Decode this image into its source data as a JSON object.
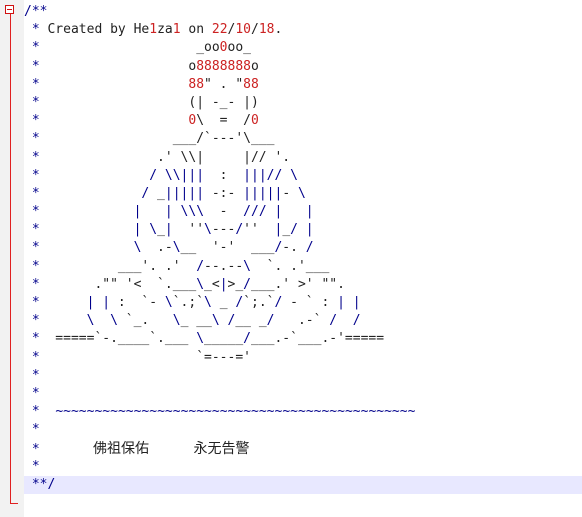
{
  "editor": {
    "lines": [
      {
        "star": "/**",
        "text": ""
      },
      {
        "star": " *",
        "text": " Created by He1za1 on 22/10/18."
      },
      {
        "star": " *",
        "text": "                    _oo0oo_"
      },
      {
        "star": " *",
        "text": "                   o8888888o"
      },
      {
        "star": " *",
        "text": "                   88\" . \"88"
      },
      {
        "star": " *",
        "text": "                   (| -_- |)"
      },
      {
        "star": " *",
        "text": "                   0\\  =  /0"
      },
      {
        "star": " *",
        "text": "                 ___/`---'\\___"
      },
      {
        "star": " *",
        "text": "               .' \\\\|     |// '."
      },
      {
        "star": " *",
        "text": "              / \\\\|||  :  |||// \\"
      },
      {
        "star": " *",
        "text": "             / _||||| -:- |||||- \\"
      },
      {
        "star": " *",
        "text": "            |   | \\\\\\  -  /// |   |"
      },
      {
        "star": " *",
        "text": "            | \\_|  ''\\---/''  |_/ |"
      },
      {
        "star": " *",
        "text": "            \\  .-\\__  '-'  ___/-. /"
      },
      {
        "star": " *",
        "text": "          ___'. .'  /--.--\\  `. .'___"
      },
      {
        "star": " *",
        "text": "       .\"\" '<  `.___\\_<|>_/___.' >' \"\"."
      },
      {
        "star": " *",
        "text": "      | | :  `- \\`.;`\\ _ /`;.`/ - ` : | |"
      },
      {
        "star": " *",
        "text": "      \\  \\ `_.   \\_ __\\ /__ _/   .-` /  /"
      },
      {
        "star": " *",
        "text": "  =====`-.____`.___ \\_____/___.-`___.-'====="
      },
      {
        "star": " *",
        "text": "                    `=---='"
      },
      {
        "star": " *",
        "text": ""
      },
      {
        "star": " *",
        "text": ""
      },
      {
        "star": " *",
        "text": "  ~~~~~~~~~~~~~~~~~~~~~~~~~~~~~~~~~~~~~~~~~~~~~~"
      },
      {
        "star": " *",
        "text": ""
      },
      {
        "star": " *",
        "text": "            佛祖保佑          永无告警"
      },
      {
        "star": " *",
        "text": ""
      },
      {
        "star": " **/",
        "text": ""
      }
    ]
  },
  "colors": {
    "comment_star": "#00008b",
    "number": "#cc2222",
    "current_line": "#e8e8ff",
    "fold": "#e02020"
  }
}
